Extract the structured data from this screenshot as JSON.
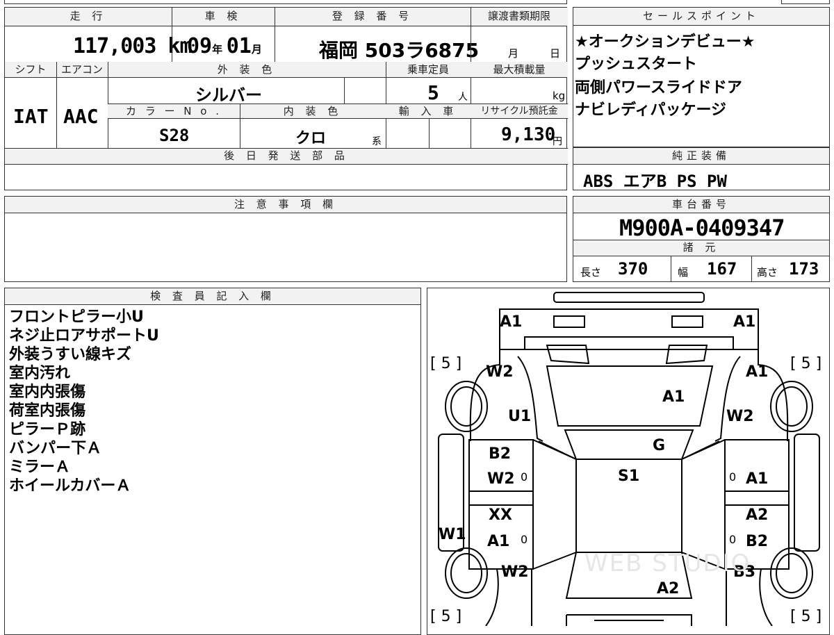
{
  "top": {
    "headers": {
      "mileage": "走 行",
      "inspection": "車 検",
      "registration": "登 録 番 号",
      "transfer_deadline": "譲渡書類期限",
      "shift": "シフト",
      "aircon": "エアコン",
      "exterior_color": "外 装 色",
      "capacity": "乗車定員",
      "max_load": "最大積載量",
      "color_no": "カ ラ ー N o .",
      "interior_color": "内 装 色",
      "import": "輸 入 車",
      "recycle": "リサイクル預託金",
      "later_parts": "後 日 発 送 部 品"
    },
    "mileage_value": "117,003 km",
    "inspection_year": "09",
    "inspection_year_unit": "年",
    "inspection_month": "01",
    "inspection_month_unit": "月",
    "registration_value": "福岡 503ラ6875",
    "transfer_month": "月",
    "transfer_day": "日",
    "shift_value": "IAT",
    "aircon_value": "AAC",
    "exterior_value": "シルバー",
    "capacity_value": "5",
    "capacity_unit": "人",
    "max_load_unit": "kg",
    "color_no_value": "S28",
    "interior_value": "クロ",
    "interior_suffix": "系",
    "recycle_value": "9,130",
    "recycle_unit": "円"
  },
  "sales": {
    "header": "セールスポイント",
    "items": [
      "★オークションデビュー★",
      "プッシュスタート",
      "両側パワースライドドア",
      "ナビレディパッケージ"
    ]
  },
  "equipment": {
    "header": "純正装備",
    "value": "ABS エアB PS PW"
  },
  "notes": {
    "header": "注 意 事 項 欄"
  },
  "chassis": {
    "header": "車台番号",
    "value": "M900A-0409347"
  },
  "specs": {
    "header": "諸 元",
    "length_label": "長さ",
    "length_value": "370",
    "width_label": "幅",
    "width_value": "167",
    "height_label": "高さ",
    "height_value": "173"
  },
  "inspector": {
    "header": "検 査 員 記 入 欄",
    "lines": [
      "フロントピラー小U",
      "ネジ止ロアサポートU",
      "外装うすい線キズ",
      "室内汚れ",
      "室内内張傷",
      "荷室内張傷",
      "ピラーＰ跡",
      "バンパー下Ａ",
      "ミラーＡ",
      "ホイールカバーＡ"
    ]
  },
  "diagram": {
    "codes": {
      "front_left": "A1",
      "front_right": "A1",
      "tire_fl": "[ 5 ]",
      "tire_fr": "[ 5 ]",
      "tire_rl": "[ 5 ]",
      "tire_rr": "[ 5 ]",
      "fender_fl": "W2",
      "fender_fr": "A1",
      "bonnet": "A1",
      "pillar_l": "U1",
      "fender_fr2": "W2",
      "windshield": "G",
      "door_fl_1": "B2",
      "door_fl_2": "W2",
      "roof": "S1",
      "door_fr": "A1",
      "door_rl_1": "XX",
      "door_rl_2": "A1",
      "door_rr_1": "A2",
      "door_rr_2": "B2",
      "step_l": "W1",
      "quarter_rl": "W2",
      "quarter_rr": "B3",
      "rear": "A2",
      "zero": "0"
    },
    "watermark": "WEB STUDIO"
  }
}
